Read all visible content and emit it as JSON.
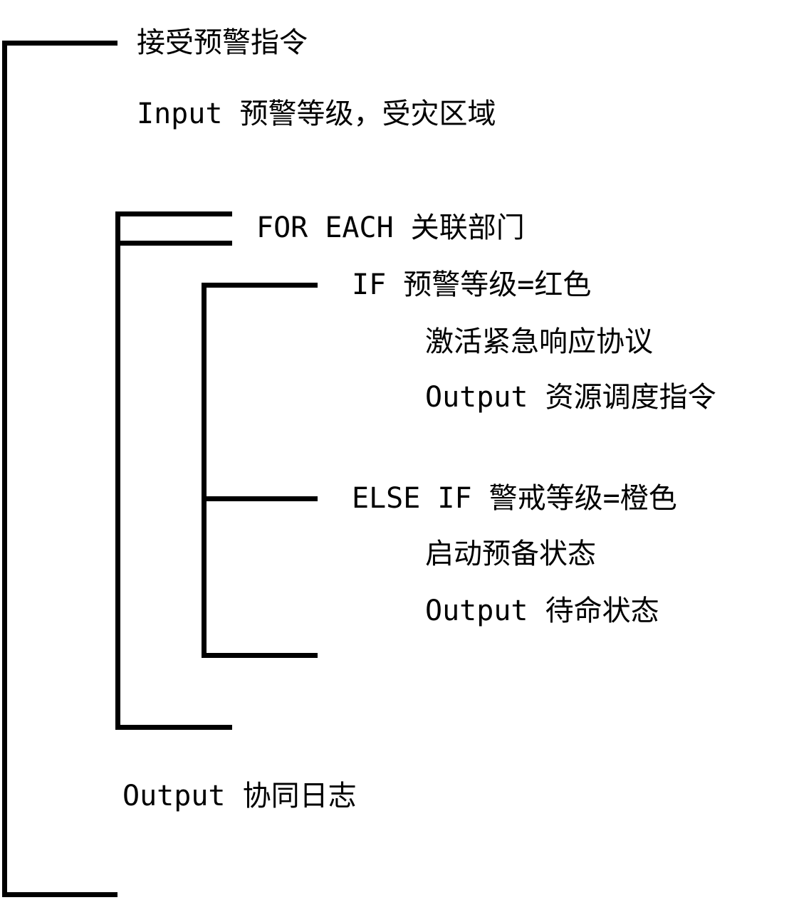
{
  "title": "接受预警指令",
  "input_line": "Input 预警等级，受灾区域",
  "loop_header": "FOR EACH 关联部门",
  "if_branch": {
    "condition": "IF 预警等级=红色",
    "action": "激活紧急响应协议",
    "output": "Output 资源调度指令"
  },
  "else_if_branch": {
    "condition": "ELSE IF 警戒等级=橙色",
    "action": "启动预备状态",
    "output": "Output 待命状态"
  },
  "final_output": "Output 协同日志"
}
